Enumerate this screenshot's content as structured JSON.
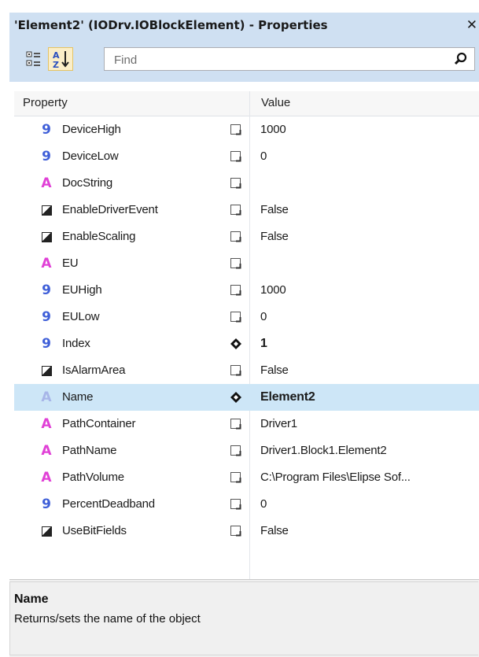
{
  "window": {
    "title": "'Element2' (IODrv.IOBlockElement) - Properties",
    "close_glyph": "✕"
  },
  "toolbar": {
    "categorized_icon": "categorized-icon",
    "alphabetical_icon": "sort-az-icon",
    "search_placeholder": "Find",
    "search_value": "",
    "search_icon": "magnifier-icon"
  },
  "grid": {
    "header_property": "Property",
    "header_value": "Value",
    "rows": [
      {
        "type": "number",
        "name": "DeviceHigh",
        "value": "1000",
        "attr": "page"
      },
      {
        "type": "number",
        "name": "DeviceLow",
        "value": "0",
        "attr": "page"
      },
      {
        "type": "string",
        "name": "DocString",
        "value": "",
        "attr": "page"
      },
      {
        "type": "bool",
        "name": "EnableDriverEvent",
        "value": "False",
        "attr": "page"
      },
      {
        "type": "bool",
        "name": "EnableScaling",
        "value": "False",
        "attr": "page"
      },
      {
        "type": "string",
        "name": "EU",
        "value": "",
        "attr": "page"
      },
      {
        "type": "number",
        "name": "EUHigh",
        "value": "1000",
        "attr": "page"
      },
      {
        "type": "number",
        "name": "EULow",
        "value": "0",
        "attr": "page"
      },
      {
        "type": "number",
        "name": "Index",
        "value": "1",
        "attr": "key"
      },
      {
        "type": "bool",
        "name": "IsAlarmArea",
        "value": "False",
        "attr": "page"
      },
      {
        "type": "string",
        "name": "Name",
        "value": "Element2",
        "attr": "key",
        "selected": true
      },
      {
        "type": "string",
        "name": "PathContainer",
        "value": "Driver1",
        "attr": "page"
      },
      {
        "type": "string",
        "name": "PathName",
        "value": "Driver1.Block1.Element2",
        "attr": "page"
      },
      {
        "type": "string",
        "name": "PathVolume",
        "value": "C:\\Program Files\\Elipse Sof...",
        "attr": "page"
      },
      {
        "type": "number",
        "name": "PercentDeadband",
        "value": "0",
        "attr": "page"
      },
      {
        "type": "bool",
        "name": "UseBitFields",
        "value": "False",
        "attr": "page"
      }
    ]
  },
  "description": {
    "title": "Name",
    "text": "Returns/sets the name of the object"
  },
  "colors": {
    "title_bg": "#cfe0f2",
    "selected_row": "#cde6f7",
    "number_icon": "#3f5fd8",
    "string_icon": "#e040d6"
  }
}
